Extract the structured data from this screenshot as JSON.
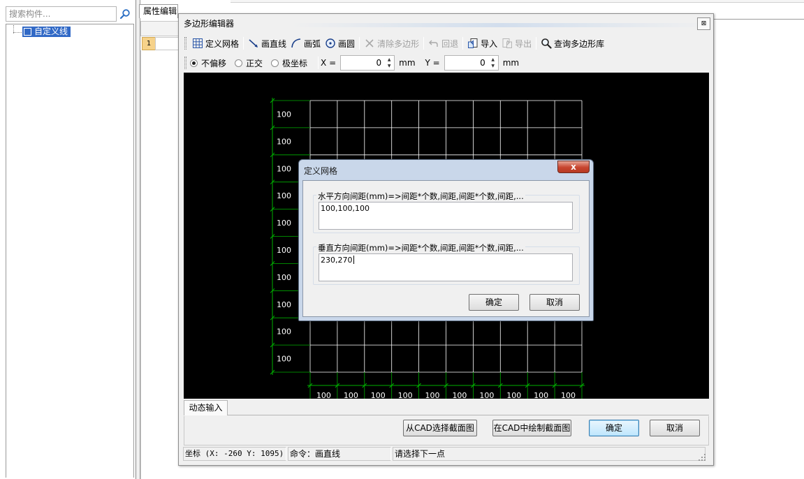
{
  "left_panel": {
    "search_placeholder": "搜索构件...",
    "tree_item_label": "自定义线"
  },
  "property_editor": {
    "tab_label": "属性编辑",
    "row_number": "1"
  },
  "editor": {
    "title": "多边形编辑器",
    "close_glyph": "⊠",
    "toolbar": {
      "define_grid": "定义网格",
      "draw_line": "画直线",
      "draw_arc": "画弧",
      "draw_circle": "画圆",
      "clear_polygon": "清除多边形",
      "undo": "回退",
      "import": "导入",
      "export": "导出",
      "query_library": "查询多边形库"
    },
    "options": {
      "no_offset": "不偏移",
      "orthogonal": "正交",
      "polar": "极坐标",
      "x_label": "X =",
      "x_value": "0",
      "x_unit": "mm",
      "y_label": "Y =",
      "y_value": "0",
      "y_unit": "mm"
    },
    "canvas": {
      "grid_color": "#ffffff",
      "axis_color": "#00b000",
      "label_color": "#ffffff",
      "left_labels": [
        "100",
        "100",
        "100",
        "100",
        "100",
        "100",
        "100",
        "100",
        "100",
        "100"
      ],
      "bottom_labels": [
        "100",
        "100",
        "100",
        "100",
        "100",
        "100",
        "100",
        "100",
        "100",
        "100"
      ]
    },
    "dynamic_input_tab": "动态输入",
    "buttons": {
      "select_from_cad": "从CAD选择截面图",
      "draw_in_cad": "在CAD中绘制截面图",
      "ok": "确定",
      "cancel": "取消"
    },
    "status": {
      "coordinate": "坐标 (X: -260 Y: 1095)",
      "command": "命令：画直线",
      "prompt": "请选择下一点"
    }
  },
  "dialog": {
    "title": "定义网格",
    "close_glyph": "x",
    "horizontal_label": "水平方向间距(mm)=>间距*个数,间距,间距*个数,间距,...",
    "horizontal_value": "100,100,100",
    "vertical_label": "垂直方向间距(mm)=>间距*个数,间距,间距*个数,间距,...",
    "vertical_value": "230,270",
    "ok": "确定",
    "cancel": "取消"
  }
}
